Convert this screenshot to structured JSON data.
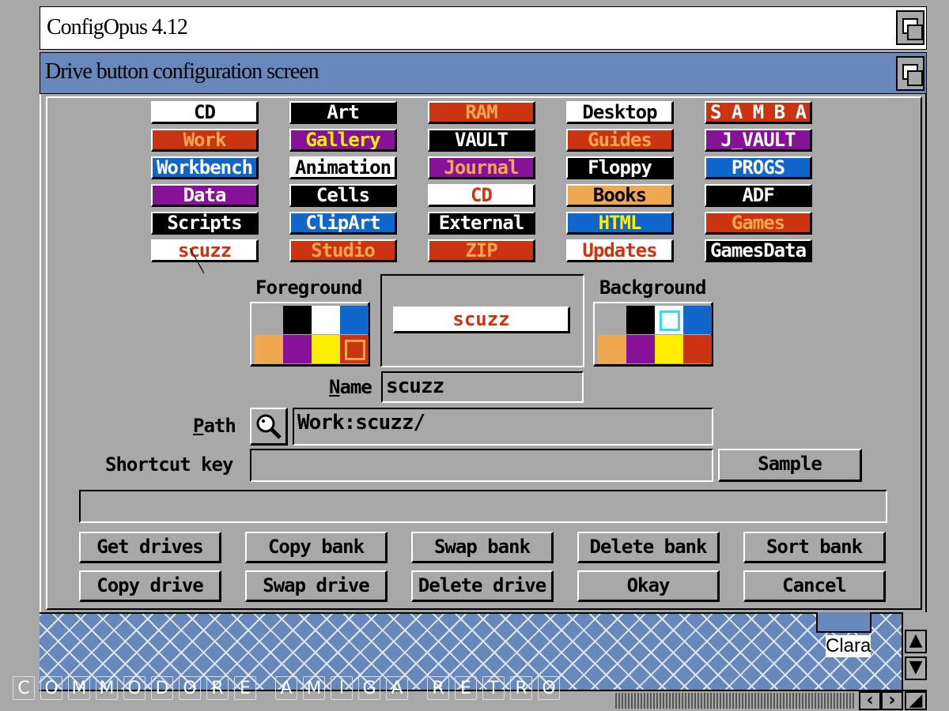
{
  "window": {
    "app_title": "ConfigOpus 4.12",
    "screen_title": "Drive button configuration screen"
  },
  "banks": [
    [
      {
        "label": "CD",
        "fg": "#000000",
        "bg": "#ffffff"
      },
      {
        "label": "Work",
        "fg": "#f0a850",
        "bg": "#cc3311"
      },
      {
        "label": "Workbench",
        "fg": "#ffffff",
        "bg": "#1166cc"
      },
      {
        "label": "Data",
        "fg": "#ffffff",
        "bg": "#881199"
      },
      {
        "label": "Scripts",
        "fg": "#ffffff",
        "bg": "#000000"
      },
      {
        "label": "scuzz",
        "fg": "#cc3311",
        "bg": "#ffffff"
      }
    ],
    [
      {
        "label": "Art",
        "fg": "#ffffff",
        "bg": "#000000"
      },
      {
        "label": "Gallery",
        "fg": "#ffee00",
        "bg": "#881199"
      },
      {
        "label": "Animation",
        "fg": "#000000",
        "bg": "#ffffff"
      },
      {
        "label": "Cells",
        "fg": "#ffffff",
        "bg": "#000000"
      },
      {
        "label": "ClipArt",
        "fg": "#ffffff",
        "bg": "#1166cc"
      },
      {
        "label": "Studio",
        "fg": "#f0a850",
        "bg": "#cc3311"
      }
    ],
    [
      {
        "label": "RAM",
        "fg": "#f0a850",
        "bg": "#cc3311"
      },
      {
        "label": "VAULT",
        "fg": "#ffffff",
        "bg": "#000000"
      },
      {
        "label": "Journal",
        "fg": "#f0a850",
        "bg": "#881199"
      },
      {
        "label": "CD",
        "fg": "#cc3311",
        "bg": "#ffffff"
      },
      {
        "label": "External",
        "fg": "#ffffff",
        "bg": "#000000"
      },
      {
        "label": "ZIP",
        "fg": "#f0a850",
        "bg": "#cc3311"
      }
    ],
    [
      {
        "label": "Desktop",
        "fg": "#000000",
        "bg": "#ffffff"
      },
      {
        "label": "Guides",
        "fg": "#f0a850",
        "bg": "#cc3311"
      },
      {
        "label": "Floppy",
        "fg": "#ffffff",
        "bg": "#000000"
      },
      {
        "label": "Books",
        "fg": "#000000",
        "bg": "#f0a850"
      },
      {
        "label": "HTML",
        "fg": "#ffee00",
        "bg": "#1166cc"
      },
      {
        "label": "Updates",
        "fg": "#cc3311",
        "bg": "#ffffff"
      }
    ],
    [
      {
        "label": "S A M B A",
        "fg": "#ffffff",
        "bg": "#cc3311"
      },
      {
        "label": "J_VAULT",
        "fg": "#ffffff",
        "bg": "#881199"
      },
      {
        "label": "PROGS",
        "fg": "#ffffff",
        "bg": "#1166cc"
      },
      {
        "label": "ADF",
        "fg": "#ffffff",
        "bg": "#000000"
      },
      {
        "label": "Games",
        "fg": "#f0a850",
        "bg": "#cc3311"
      },
      {
        "label": "GamesData",
        "fg": "#ffffff",
        "bg": "#000000"
      }
    ]
  ],
  "palette_colors": [
    "#a8a8a8",
    "#000000",
    "#ffffff",
    "#1166cc",
    "#f0a850",
    "#881199",
    "#ffee00",
    "#cc3311"
  ],
  "foreground": {
    "label": "Foreground",
    "selected_index": 7
  },
  "background": {
    "label": "Background",
    "selected_index": 2
  },
  "preview": {
    "label": "scuzz"
  },
  "name": {
    "label": "Name",
    "value": "scuzz"
  },
  "path": {
    "label": "Path",
    "value": "Work:scuzz/"
  },
  "shortcut": {
    "label": "Shortcut key",
    "value": "",
    "sample_label": "Sample"
  },
  "status": {
    "value": ""
  },
  "buttons": {
    "get_drives": "Get drives",
    "copy_bank": "Copy bank",
    "swap_bank": "Swap bank",
    "delete_bank": "Delete bank",
    "sort_bank": "Sort bank",
    "copy_drive": "Copy drive",
    "swap_drive": "Swap drive",
    "delete_drive": "Delete drive",
    "okay": "Okay",
    "cancel": "Cancel"
  },
  "backdrop": {
    "icon_label": "Clara"
  },
  "watermark": [
    "C",
    "O",
    "M",
    "M",
    "O",
    "D",
    "O",
    "R",
    "E",
    " ",
    "A",
    "M",
    "I",
    "G",
    "A",
    " ",
    "R",
    "E",
    "T",
    "R",
    "O"
  ]
}
